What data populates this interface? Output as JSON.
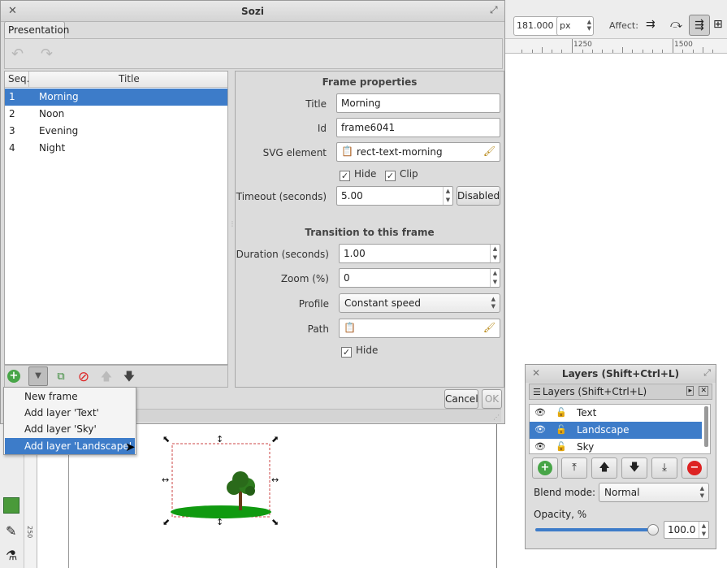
{
  "inkscape": {
    "toolbar": {
      "w_value": "181.000",
      "unit": "px",
      "affect_label": "Affect:"
    },
    "ruler_top_labels": [
      "1250",
      "1500"
    ],
    "ruler_left_label": "250"
  },
  "sozi": {
    "title": "Sozi",
    "tab": "Presentation",
    "list": {
      "headers": {
        "seq": "Seq.",
        "title": "Title"
      },
      "rows": [
        {
          "seq": "1",
          "title": "Morning"
        },
        {
          "seq": "2",
          "title": "Noon"
        },
        {
          "seq": "3",
          "title": "Evening"
        },
        {
          "seq": "4",
          "title": "Night"
        }
      ]
    },
    "menu": [
      "New frame",
      "Add layer 'Text'",
      "Add layer 'Sky'",
      "Add layer 'Landscape'"
    ],
    "props": {
      "heading": "Frame properties",
      "title_label": "Title",
      "title_value": "Morning",
      "id_label": "Id",
      "id_value": "frame6041",
      "svg_label": "SVG element",
      "svg_value": "rect-text-morning",
      "hide_label": "Hide",
      "clip_label": "Clip",
      "timeout_label": "Timeout (seconds)",
      "timeout_value": "5.00",
      "disabled_button": "Disabled",
      "transition_heading": "Transition to this frame",
      "duration_label": "Duration (seconds)",
      "duration_value": "1.00",
      "zoom_label": "Zoom (%)",
      "zoom_value": "0",
      "profile_label": "Profile",
      "profile_value": "Constant speed",
      "path_label": "Path",
      "path_hide_label": "Hide"
    },
    "cancel": "Cancel",
    "ok": "OK"
  },
  "layers": {
    "title": "Layers (Shift+Ctrl+L)",
    "tab": "Layers (Shift+Ctrl+L)",
    "items": [
      {
        "name": "Text"
      },
      {
        "name": "Landscape"
      },
      {
        "name": "Sky"
      }
    ],
    "blend_label": "Blend mode:",
    "blend_value": "Normal",
    "opacity_label": "Opacity, %",
    "opacity_value": "100.0",
    "opacity_fraction": 1.0
  }
}
